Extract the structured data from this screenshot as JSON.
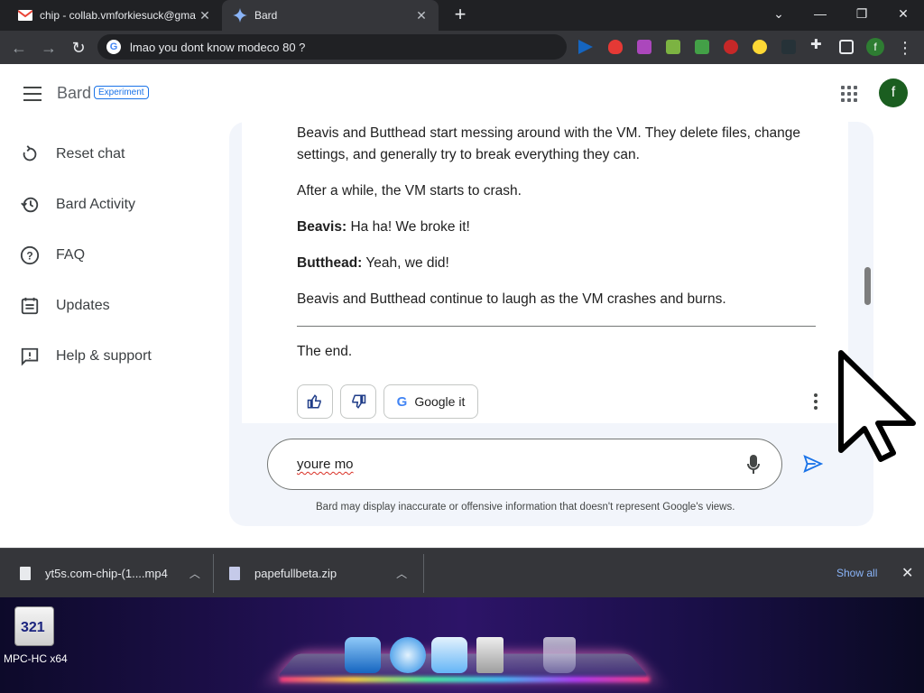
{
  "browser": {
    "tabs": [
      {
        "title": "chip - collab.vmforkiesuck@gma",
        "icon": "gmail-icon"
      },
      {
        "title": "Bard",
        "icon": "bard-sparkle-icon"
      }
    ],
    "omnibox_value": "lmao you dont know modeco 80 ?",
    "profile_initial": "f"
  },
  "bard": {
    "brand": "Bard",
    "badge": "Experiment",
    "avatar_initial": "f",
    "sidebar": [
      {
        "label": "Reset chat",
        "icon": "reset-icon"
      },
      {
        "label": "Bard Activity",
        "icon": "history-icon"
      },
      {
        "label": "FAQ",
        "icon": "help-circle-icon"
      },
      {
        "label": "Updates",
        "icon": "updates-icon"
      },
      {
        "label": "Help & support",
        "icon": "feedback-icon"
      }
    ],
    "response": {
      "p1": "Beavis and Butthead start messing around with the VM. They delete files, change settings, and generally try to break everything they can.",
      "p2": "After a while, the VM starts to crash.",
      "p3_speaker": "Beavis:",
      "p3_text": " Ha ha! We broke it!",
      "p4_speaker": "Butthead:",
      "p4_text": " Yeah, we did!",
      "p5": "Beavis and Butthead continue to laugh as the VM crashes and burns.",
      "p6": "The end."
    },
    "actions": {
      "google_it": "Google it"
    },
    "prompt_value": "youre mo",
    "disclaimer": "Bard may display inaccurate or offensive information that doesn't represent Google's views."
  },
  "downloads": {
    "items": [
      {
        "name": "yt5s.com-chip-(1....mp4"
      },
      {
        "name": "papefullbeta.zip"
      }
    ],
    "show_all": "Show all"
  },
  "desktop": {
    "icon_label": "MPC-HC x64",
    "icon_text": "321"
  },
  "colors": {
    "chrome_dark": "#202124",
    "chrome_toolbar": "#35363a",
    "bard_panel": "#f2f5fb",
    "accent_blue": "#1a73e8"
  }
}
